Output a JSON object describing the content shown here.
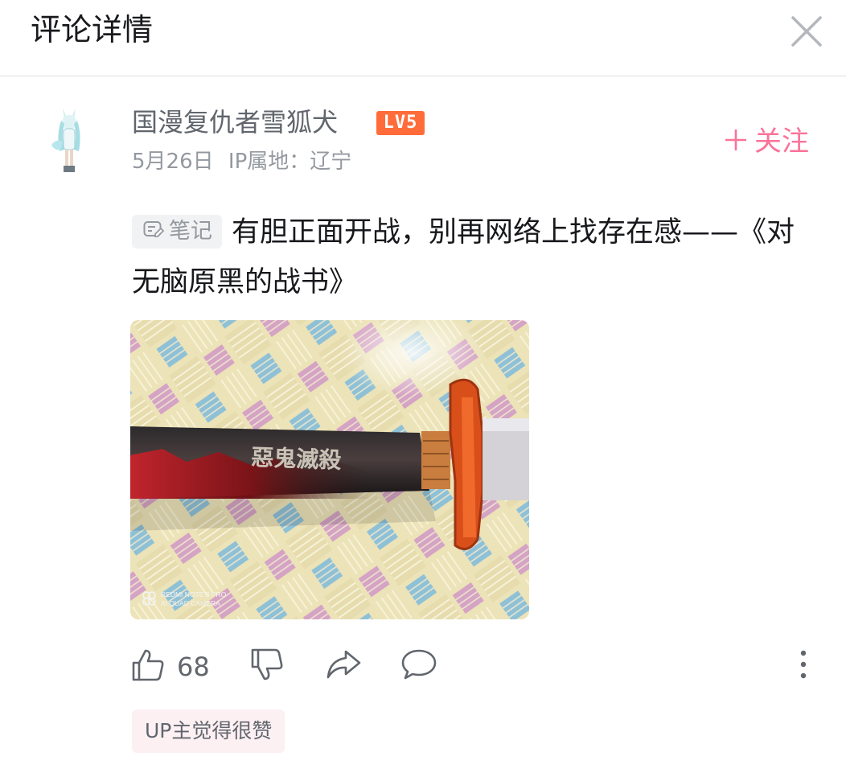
{
  "header": {
    "title": "评论详情"
  },
  "author": {
    "name": "国漫复仇者雪狐犬",
    "level": "LV5",
    "date": "5月26日",
    "ip_location": "IP属地：辽宁",
    "follow_label": "关注"
  },
  "comment": {
    "tag": "笔记",
    "text": "有胆正面开战，别再网络上找存在感——《对无脑原黑的战书》"
  },
  "photo": {
    "blade_text": "惡鬼滅殺",
    "watermark_line1": "REDMI NOTE 8 PRO",
    "watermark_line2": "AI QUAD CAMERA"
  },
  "actions": {
    "like_count": "68"
  },
  "up_badge": "UP主觉得很赞",
  "colors": {
    "accent_pink": "#fb7299",
    "level_orange": "#ff6c3a",
    "muted_text": "#9499a0"
  }
}
